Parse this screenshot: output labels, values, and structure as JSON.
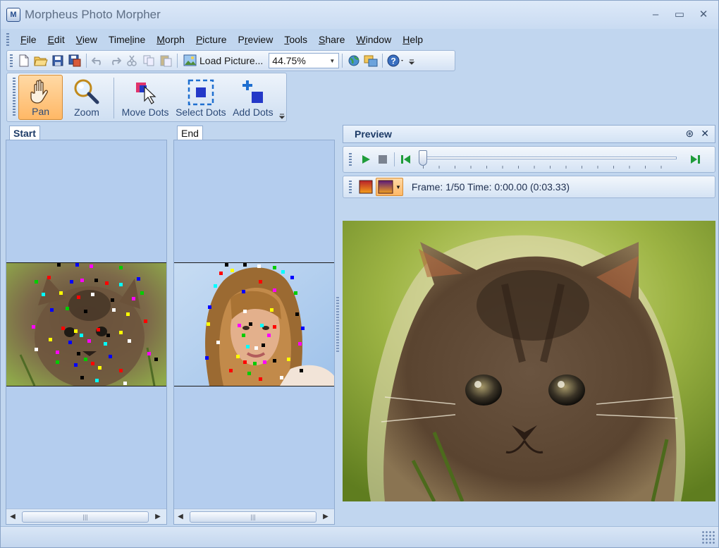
{
  "window": {
    "title": "Morpheus Photo Morpher"
  },
  "menu": [
    {
      "pre": "",
      "key": "F",
      "post": "ile"
    },
    {
      "pre": "",
      "key": "E",
      "post": "dit"
    },
    {
      "pre": "",
      "key": "V",
      "post": "iew"
    },
    {
      "pre": "Time",
      "key": "l",
      "post": "ine"
    },
    {
      "pre": "",
      "key": "M",
      "post": "orph"
    },
    {
      "pre": "",
      "key": "P",
      "post": "icture"
    },
    {
      "pre": "P",
      "key": "r",
      "post": "eview"
    },
    {
      "pre": "",
      "key": "T",
      "post": "ools"
    },
    {
      "pre": "",
      "key": "S",
      "post": "hare"
    },
    {
      "pre": "",
      "key": "W",
      "post": "indow"
    },
    {
      "pre": "",
      "key": "H",
      "post": "elp"
    }
  ],
  "toolbar": {
    "load_label": "Load Picture...",
    "zoom_value": "44.75%"
  },
  "tools": {
    "pan": "Pan",
    "zoom": "Zoom",
    "move_dots": "Move Dots",
    "select_dots": "Select Dots",
    "add_dots": "Add Dots"
  },
  "panels": {
    "start_tab": "Start",
    "end_tab": "End"
  },
  "preview": {
    "title": "Preview",
    "frame_info": "Frame: 1/50 Time: 0:00.00 (0:03.33)",
    "position_fraction": 0.0
  },
  "colors": {
    "window_bg": "#c1d6ef",
    "active_tool": "#ffb866",
    "accent": "#1c3a66"
  }
}
